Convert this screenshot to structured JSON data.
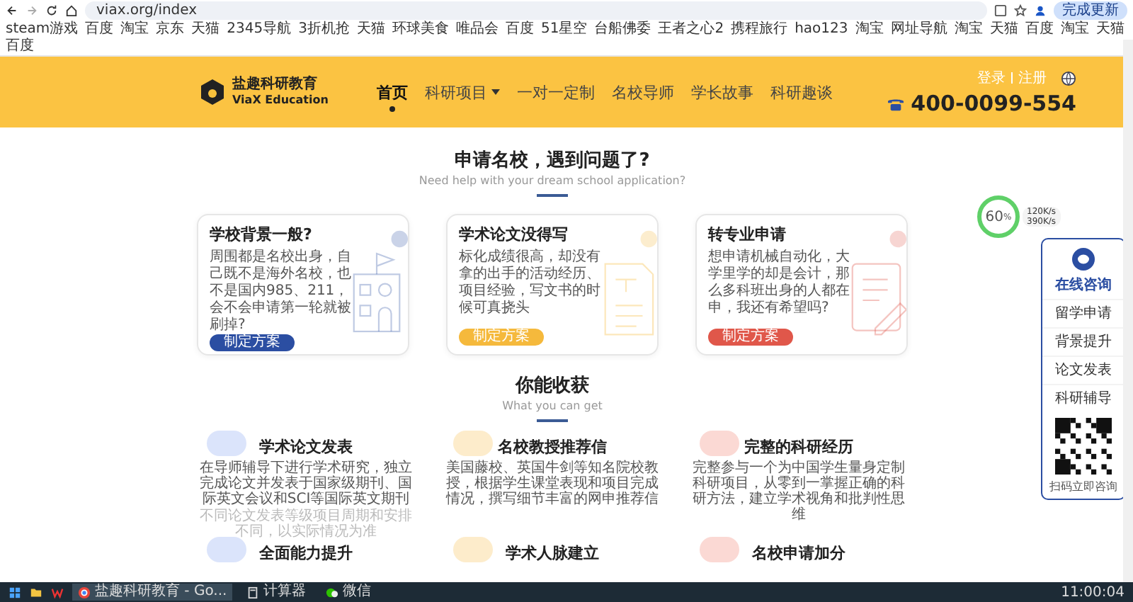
{
  "browser": {
    "url": "viax.org/index",
    "update_button": "完成更新"
  },
  "bookmarks": [
    "steam游戏",
    "百度",
    "淘宝",
    "京东",
    "天猫",
    "2345导航",
    "3折机抢",
    "天猫",
    "环球美食",
    "唯品会",
    "百度",
    "51星空",
    "台船佛委",
    "王者之心2",
    "携程旅行",
    "hao123",
    "淘宝",
    "网址导航",
    "淘宝",
    "天猫",
    "百度",
    "淘宝",
    "天猫",
    "百度"
  ],
  "header": {
    "logo_name": "盐趣科研教育",
    "logo_subtitle": "ViaX Education",
    "login": "登录",
    "register": "注册",
    "phone": "400-0099-554",
    "nav": [
      {
        "label": "首页",
        "selected": true,
        "dropdown": false
      },
      {
        "label": "科研项目",
        "selected": false,
        "dropdown": true
      },
      {
        "label": "一对一定制",
        "selected": false,
        "dropdown": false
      },
      {
        "label": "名校导师",
        "selected": false,
        "dropdown": false
      },
      {
        "label": "学长故事",
        "selected": false,
        "dropdown": false
      },
      {
        "label": "科研趣谈",
        "selected": false,
        "dropdown": false
      }
    ]
  },
  "intro": {
    "title": "申请名校，遇到问题了?",
    "subtitle": "Need help with your dream school application?",
    "cards": [
      {
        "title": "学校背景一般?",
        "text": "周围都是名校出身，自己既不是海外名校，也不是国内985、211，会不会申请第一轮就被刷掉?",
        "button": "制定方案",
        "color": "#2b4ea2",
        "kind": "building"
      },
      {
        "title": "学术论文没得写",
        "text": "标化成绩很高，却没有拿的出手的活动经历、项目经验，写文书的时候可真挠头",
        "button": "制定方案",
        "color": "#f5b93c",
        "kind": "document"
      },
      {
        "title": "转专业申请",
        "text": "想申请机械自动化，大学里学的却是会计，那么多科班出身的人都在申，我还有希望吗?",
        "button": "制定方案",
        "color": "#e0574a",
        "kind": "pencil"
      }
    ]
  },
  "benefits": {
    "title": "你能收获",
    "subtitle": "What you can get",
    "items": [
      {
        "title": "学术论文发表",
        "text": "在导师辅导下进行学术研究，独立完成论文并发表于国家级期刊、国际英文会议和SCI等国际英文期刊",
        "note": "不同论文发表等级项目周期和安排不同，以实际情况为准",
        "color": "#dbe4fb"
      },
      {
        "title": "名校教授推荐信",
        "text": "美国藤校、英国牛剑等知名院校教授，根据学生课堂表现和项目完成情况，撰写细节丰富的网申推荐信",
        "color": "#fdeccb"
      },
      {
        "title": "完整的科研经历",
        "text": "完整参与一个为中国学生量身定制科研项目，从零到一掌握正确的科研方法，建立学术视角和批判性思维",
        "color": "#fbd9d4"
      },
      {
        "title": "全面能力提升",
        "color": "#dbe4fb"
      },
      {
        "title": "学术人脉建立",
        "color": "#fdeccb"
      },
      {
        "title": "名校申请加分",
        "color": "#fbd9d4"
      }
    ]
  },
  "widget": {
    "percent": "60",
    "unit": "%",
    "upload": "120K/s",
    "download": "390K/s"
  },
  "side_panel": {
    "title": "在线咨询",
    "items": [
      "留学申请",
      "背景提升",
      "论文发表",
      "科研辅导"
    ],
    "qr_caption": "扫码立即咨询"
  },
  "taskbar": {
    "apps": [
      {
        "label": "盐趣科研教育 - Go...",
        "selected": true,
        "kind": "browser"
      },
      {
        "label": "计算器",
        "selected": false,
        "kind": "calculator"
      },
      {
        "label": "微信",
        "selected": false,
        "kind": "chat"
      }
    ],
    "time": "11:00:04"
  }
}
